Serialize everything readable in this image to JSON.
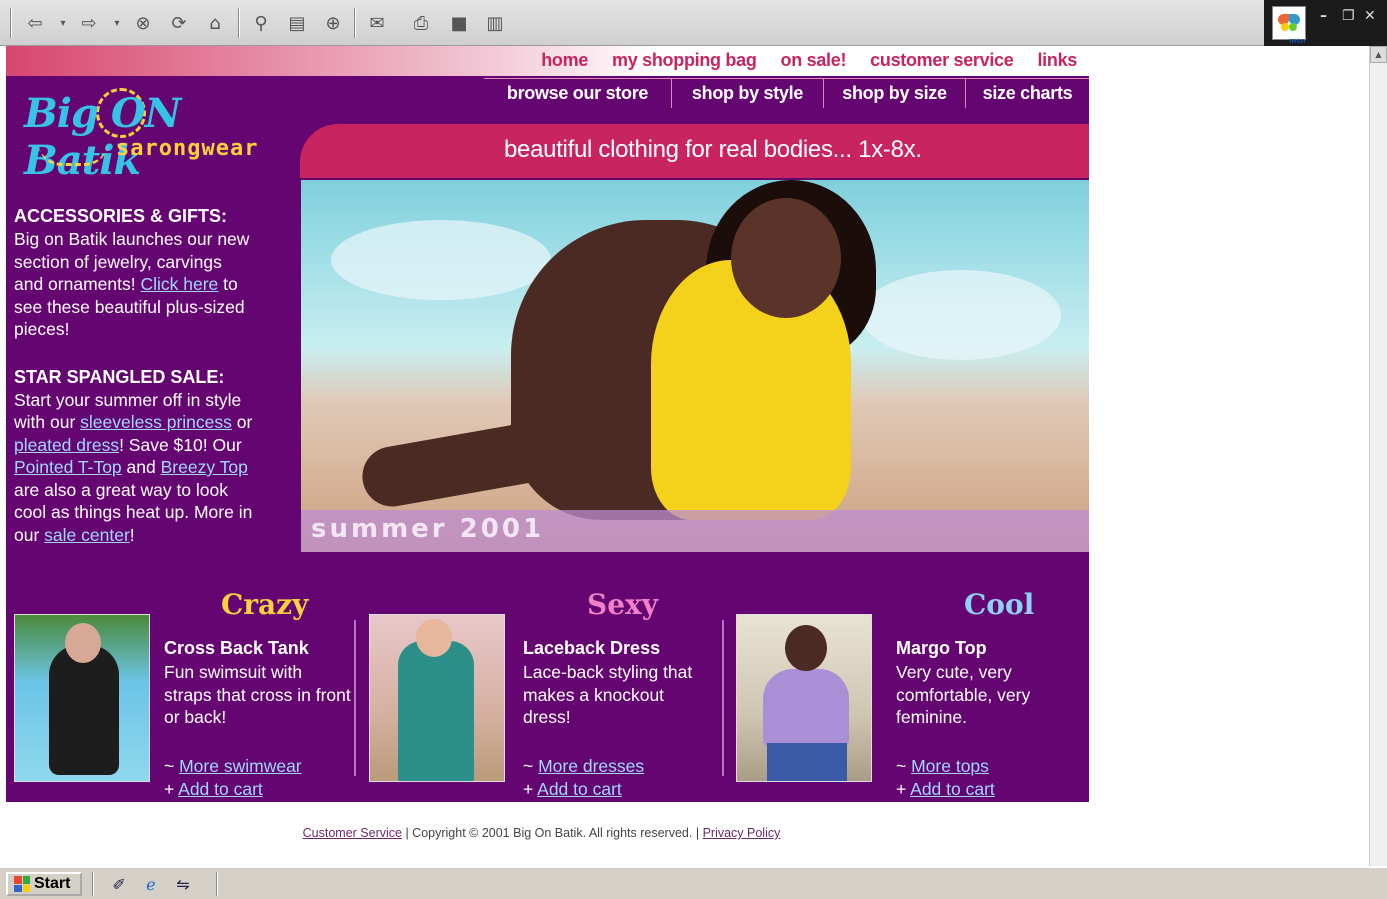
{
  "browser": {
    "toolbar_icons": [
      "back-arrow-icon",
      "forward-arrow-icon",
      "stop-icon",
      "refresh-icon",
      "home-icon",
      "search-icon",
      "favorites-icon",
      "history-icon",
      "mail-icon",
      "print-icon",
      "edit-icon",
      "discuss-icon"
    ],
    "glyphs": {
      "back": "⇦",
      "forward": "⇨",
      "stop": "⊗",
      "refresh": "⟳",
      "home": "⌂",
      "search": "⚲",
      "favorites": "▤",
      "history": "⊕",
      "mail": "✉",
      "print": "⎙",
      "edit": "■",
      "discuss": "▥"
    },
    "msn_label": "msn",
    "window_controls": {
      "minimize": "–",
      "restore": "❐",
      "close": "✕"
    }
  },
  "topnav": [
    "home",
    "my shopping bag",
    "on sale!",
    "customer service",
    "links"
  ],
  "subnav": [
    "browse our store",
    "shop by style",
    "shop by size",
    "size charts"
  ],
  "logo": {
    "line1": "Big ON Batik",
    "line2": "sarongwear"
  },
  "banner": "beautiful clothing for real bodies... 1x-8x.",
  "hero_label": "summer 2001",
  "sidebar": {
    "accessories": {
      "title": "ACCESSORIES & GIFTS:",
      "text1": "Big on Batik launches our new section of jewelry, carvings and ornaments!",
      "link": "Click here",
      "text2": "to see these beautiful plus-sized pieces!"
    },
    "sale": {
      "title": "STAR SPANGLED SALE:",
      "text1": "Start your summer off in style with our",
      "link1": "sleeveless princess",
      "text2": "or",
      "link2": "pleated dress",
      "text3": "! Save $10! Our",
      "link3": "Pointed T-Top",
      "text4": "and",
      "link4": "Breezy Top",
      "text5": "are also a great way to look cool as things heat up. More in our",
      "link5": "sale center",
      "text6": "!"
    }
  },
  "products": [
    {
      "tag": "Crazy",
      "tag_color": "#f6d23b",
      "name": "Cross Back Tank",
      "desc": "Fun swimsuit with straps that cross in front or back!",
      "more_prefix": "~",
      "more": "More swimwear",
      "add_prefix": "+",
      "add": "Add to cart"
    },
    {
      "tag": "Sexy",
      "tag_color": "#f080c8",
      "name": "Laceback Dress",
      "desc": "Lace-back styling that makes a knockout dress!",
      "more_prefix": "~",
      "more": "More dresses",
      "add_prefix": "+",
      "add": "Add to cart"
    },
    {
      "tag": "Cool",
      "tag_color": "#8fd0f5",
      "name": "Margo Top",
      "desc": "Very cute, very comfortable, very feminine.",
      "more_prefix": "~",
      "more": "More tops",
      "add_prefix": "+",
      "add": "Add to cart"
    }
  ],
  "footer": {
    "link1": "Customer Service",
    "copyright": "| Copyright © 2001 Big On Batik. All rights reserved. |",
    "link2": "Privacy Policy"
  },
  "taskbar": {
    "start": "Start"
  },
  "colors": {
    "purple": "#650571",
    "magenta": "#c8245f",
    "link": "#9fd7ff"
  }
}
